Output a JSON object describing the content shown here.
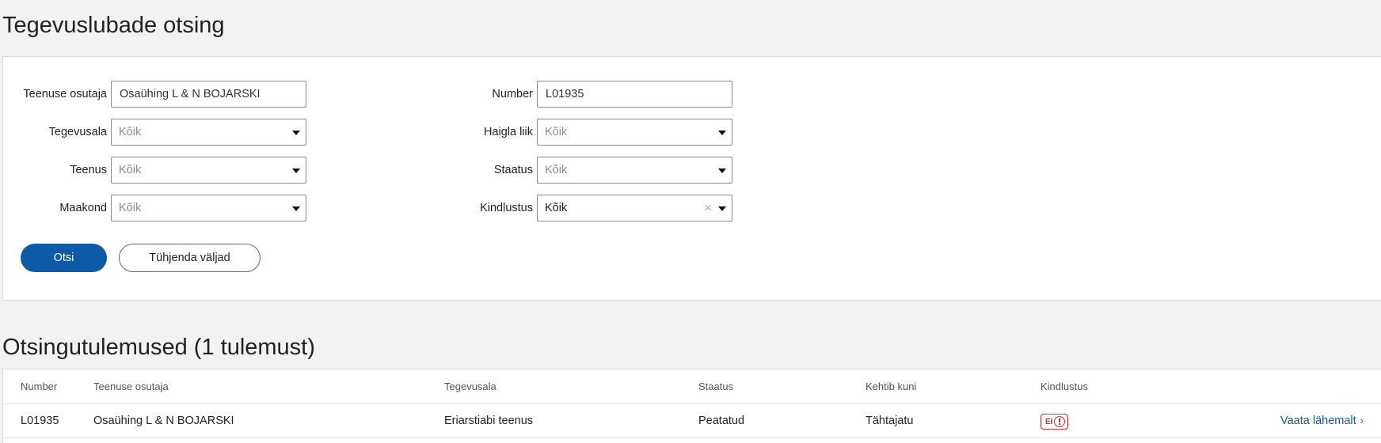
{
  "page": {
    "title": "Tegevuslubade otsing"
  },
  "search": {
    "provider_label": "Teenuse osutaja",
    "provider_value": "Osaühing L & N BOJARSKI",
    "number_label": "Number",
    "number_value": "L01935",
    "field_label": "Tegevusala",
    "field_value": "Kõik",
    "hospital_label": "Haigla liik",
    "hospital_value": "Kõik",
    "service_label": "Teenus",
    "service_value": "Kõik",
    "status_label": "Staatus",
    "status_value": "Kõik",
    "county_label": "Maakond",
    "county_value": "Kõik",
    "insurance_label": "Kindlustus",
    "insurance_value": "Kõik",
    "search_button": "Otsi",
    "clear_button": "Tühjenda väljad"
  },
  "results": {
    "title": "Otsingutulemused (1 tulemust)",
    "columns": [
      "Number",
      "Teenuse osutaja",
      "Tegevusala",
      "Staatus",
      "Kehtib kuni",
      "Kindlustus"
    ],
    "rows": [
      {
        "number": "L01935",
        "provider": "Osaühing L & N BOJARSKI",
        "field": "Eriarstiabi teenus",
        "status": "Peatatud",
        "valid_until": "Tähtajatu",
        "insurance_badge": "EI",
        "link": "Vaata lähemalt",
        "link_chevron": "›"
      }
    ]
  },
  "colors": {
    "primary": "#0d5aa7",
    "badge_red": "#d93025",
    "background": "#f2f2f2"
  }
}
